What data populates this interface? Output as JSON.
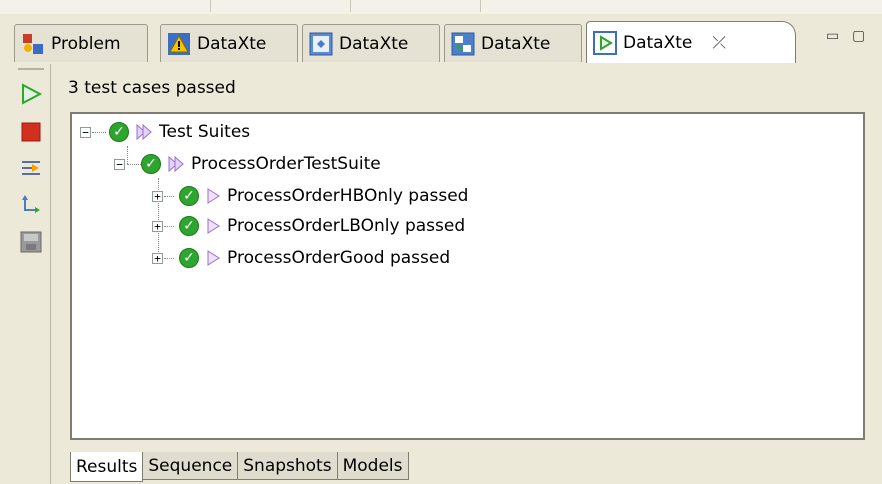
{
  "tabs": [
    {
      "label": "Problem",
      "icon": "problems-view-icon",
      "active": false
    },
    {
      "label": "DataXte",
      "icon": "warning-icon",
      "active": false
    },
    {
      "label": "DataXte",
      "icon": "test-view-icon",
      "active": false
    },
    {
      "label": "DataXte",
      "icon": "flow-view-icon",
      "active": false
    },
    {
      "label": "DataXte",
      "icon": "run-view-icon",
      "active": true
    }
  ],
  "close_symbol": "⤫",
  "window_controls": {
    "minimize": "▭",
    "maximize": "▢"
  },
  "toolbar": [
    {
      "name": "run-icon"
    },
    {
      "name": "stop-icon"
    },
    {
      "name": "step-into-icon"
    },
    {
      "name": "rerun-icon"
    },
    {
      "name": "save-icon"
    }
  ],
  "status": "3 test cases passed",
  "tree": {
    "root": {
      "label": "Test Suites",
      "expander": "−"
    },
    "suite": {
      "label": "ProcessOrderTestSuite",
      "expander": "−"
    },
    "cases": [
      {
        "label": "ProcessOrderHBOnly passed",
        "expander": "+"
      },
      {
        "label": "ProcessOrderLBOnly passed",
        "expander": "+"
      },
      {
        "label": "ProcessOrderGood passed",
        "expander": "+"
      }
    ]
  },
  "bottom_tabs": [
    "Results",
    "Sequence",
    "Snapshots",
    "Models"
  ],
  "colors": {
    "pass": "#2ea52e",
    "suite_arrow": "#b48ae0",
    "stop": "#d32f1f",
    "run": "#2ea52e"
  }
}
